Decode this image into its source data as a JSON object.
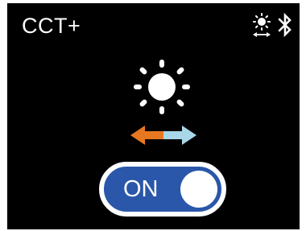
{
  "header": {
    "title": "CCT+"
  },
  "status_icons": [
    "cct-sun-arrows-icon",
    "bluetooth-icon"
  ],
  "center": {
    "icon": "sun-icon",
    "arrow_icon": "bidirectional-arrow-icon",
    "arrow_colors": {
      "left": "#e87722",
      "right": "#a8d8e8"
    }
  },
  "toggle": {
    "label": "ON",
    "state": "on",
    "track_color": "#2a57a9",
    "knob_color": "#ffffff"
  },
  "colors": {
    "background": "#000000",
    "foreground": "#ffffff"
  }
}
